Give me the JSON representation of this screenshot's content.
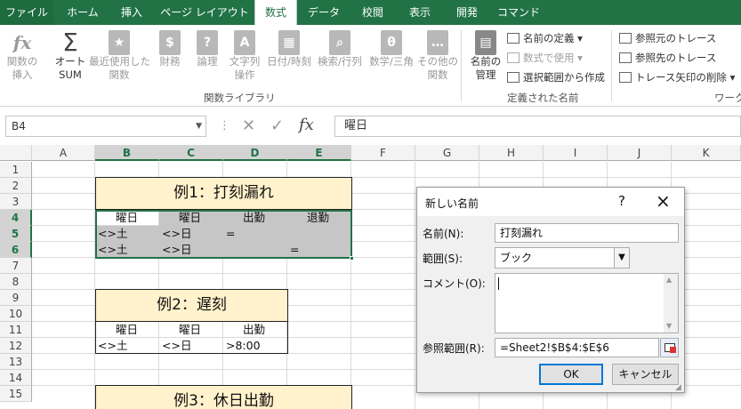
{
  "tabs": [
    "ファイル",
    "ホーム",
    "挿入",
    "ページ レイアウト",
    "数式",
    "データ",
    "校閲",
    "表示",
    "開発",
    "コマンド"
  ],
  "ribbon": {
    "buttons": [
      {
        "top": "関数の",
        "bottom": "挿入",
        "icon": "fx"
      },
      {
        "top": "オート",
        "bottom": "SUM",
        "icon": "Σ"
      },
      {
        "top": "最近使用した",
        "bottom": "関数",
        "icon": "★"
      },
      {
        "top": "財務",
        "bottom": "",
        "icon": "$"
      },
      {
        "top": "論理",
        "bottom": "",
        "icon": "?"
      },
      {
        "top": "文字列",
        "bottom": "操作",
        "icon": "A"
      },
      {
        "top": "日付/時刻",
        "bottom": "",
        "icon": "▦"
      },
      {
        "top": "検索/行列",
        "bottom": "",
        "icon": "⌕"
      },
      {
        "top": "数学/三角",
        "bottom": "",
        "icon": "θ"
      },
      {
        "top": "その他の",
        "bottom": "関数",
        "icon": "…"
      },
      {
        "top": "名前の",
        "bottom": "管理",
        "icon": "▤"
      }
    ],
    "group_functions": "関数ライブラリ",
    "group_names": "定義された名前",
    "group_audit": "ワーク",
    "define_name": "名前の定義",
    "use_in_formula": "数式で使用",
    "create_from_selection": "選択範囲から作成",
    "trace_precedents": "参照元のトレース",
    "trace_dependents": "参照先のトレース",
    "remove_arrows": "トレース矢印の削除"
  },
  "formula_bar": {
    "name_box": "B4",
    "fx": "fx",
    "content": "曜日"
  },
  "columns": [
    "A",
    "B",
    "C",
    "D",
    "E",
    "F",
    "G",
    "H",
    "I",
    "J",
    "K"
  ],
  "rows": [
    "1",
    "2",
    "3",
    "4",
    "5",
    "6",
    "7",
    "8",
    "9",
    "10",
    "11",
    "12",
    "13",
    "14",
    "15"
  ],
  "sheet": {
    "ex1_title": "例1：打刻漏れ",
    "ex1_h1": "曜日",
    "ex1_h2": "曜日",
    "ex1_h3": "出勤",
    "ex1_h4": "退勤",
    "ex1_r5b": "<>土",
    "ex1_r5c": "<>日",
    "ex1_r5d": "=",
    "ex1_r6b": "<>土",
    "ex1_r6c": "<>日",
    "ex1_r6e": "=",
    "ex2_title": "例2：遅刻",
    "ex2_h1": "曜日",
    "ex2_h2": "曜日",
    "ex2_h3": "出勤",
    "ex2_r12b": "<>土",
    "ex2_r12c": "<>日",
    "ex2_r12d": ">8:00",
    "ex3_title": "例3：休日出勤"
  },
  "dialog": {
    "title": "新しい名前",
    "help": "?",
    "close": "×",
    "name_label": "名前(N):",
    "name_value": "打刻漏れ",
    "scope_label": "範囲(S):",
    "scope_value": "ブック",
    "comment_label": "コメント(O):",
    "comment_value": "",
    "refers_label": "参照範囲(R):",
    "refers_value": "=Sheet2!$B$4:$E$6",
    "ok": "OK",
    "cancel": "キャンセル"
  }
}
